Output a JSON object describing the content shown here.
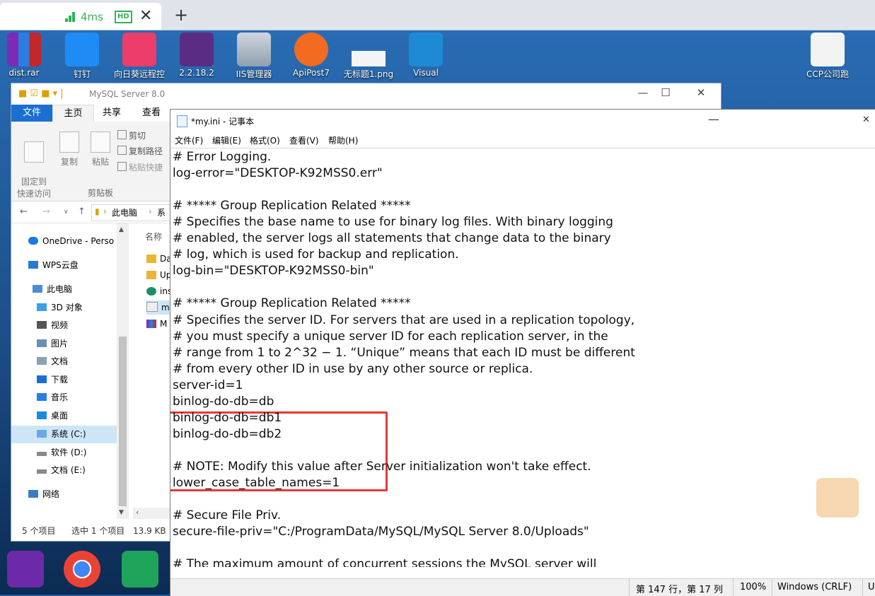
{
  "browser": {
    "tab_latency": "4ms",
    "tab_badge": "HD",
    "tab_close": "✕",
    "new_tab": "+"
  },
  "desktop_icons": [
    {
      "label": "dist.rar"
    },
    {
      "label": "钉钉"
    },
    {
      "label": "向日葵远程控"
    },
    {
      "label": "2.2.18.2"
    },
    {
      "label": "IIS管理器"
    },
    {
      "label": "ApiPost7"
    },
    {
      "label": "无标题1.png"
    },
    {
      "label": "Visual"
    },
    {
      "label": "CCP公司跑"
    }
  ],
  "explorer": {
    "title": "MySQL Server 8.0",
    "ribbon_tabs": [
      "文件",
      "主页",
      "共享",
      "查看"
    ],
    "buttons": {
      "pin": "固定到\n快速访问",
      "copy": "复制",
      "paste": "粘贴",
      "cut": "剪切",
      "copy_path": "复制路径",
      "paste_shortcut": "粘贴快捷"
    },
    "group_label": "剪贴板",
    "address": [
      "此电脑",
      "系"
    ],
    "nav_items": [
      "OneDrive - Perso",
      "WPS云盘",
      "此电脑",
      "3D 对象",
      "视频",
      "图片",
      "文档",
      "下载",
      "音乐",
      "桌面",
      "系统 (C:)",
      "软件 (D:)",
      "文档 (E:)",
      "网络"
    ],
    "column_header": "名称",
    "files": [
      "Da",
      "Up",
      "ins",
      "my",
      "M"
    ],
    "status": {
      "items": "5 个项目",
      "selected": "选中 1 个项目",
      "size": "13.9 KB"
    }
  },
  "notepad": {
    "title": "*my.ini - 记事本",
    "menus": [
      "文件(F)",
      "编辑(E)",
      "格式(O)",
      "查看(V)",
      "帮助(H)"
    ],
    "lines": [
      "# Error Logging.",
      "log-error=\"DESKTOP-K92MSS0.err\"",
      "",
      "# ***** Group Replication Related *****",
      "# Specifies the base name to use for binary log files. With binary logging",
      "# enabled, the server logs all statements that change data to the binary",
      "# log, which is used for backup and replication.",
      "log-bin=\"DESKTOP-K92MSS0-bin\"",
      "",
      "# ***** Group Replication Related *****",
      "# Specifies the server ID. For servers that are used in a replication topology,",
      "# you must specify a unique server ID for each replication server, in the",
      "# range from 1 to 2^32 − 1. “Unique” means that each ID must be different",
      "# from every other ID in use by any other source or replica.",
      "server-id=1",
      "binlog-do-db=db",
      "binlog-do-db=db1",
      "binlog-do-db=db2",
      "",
      "# NOTE: Modify this value after Server initialization won't take effect.",
      "lower_case_table_names=1",
      "",
      "# Secure File Priv.",
      "secure-file-priv=\"C:/ProgramData/MySQL/MySQL Server 8.0/Uploads\"",
      "",
      "# The maximum amount of concurrent sessions the MySQL server will"
    ],
    "status": {
      "position": "第 147 行，第 17 列",
      "zoom": "100%",
      "eol": "Windows (CRLF)",
      "enc": "U"
    }
  },
  "colors": {
    "highlight_box": "#e53935",
    "accent": "#1a6fd1"
  }
}
